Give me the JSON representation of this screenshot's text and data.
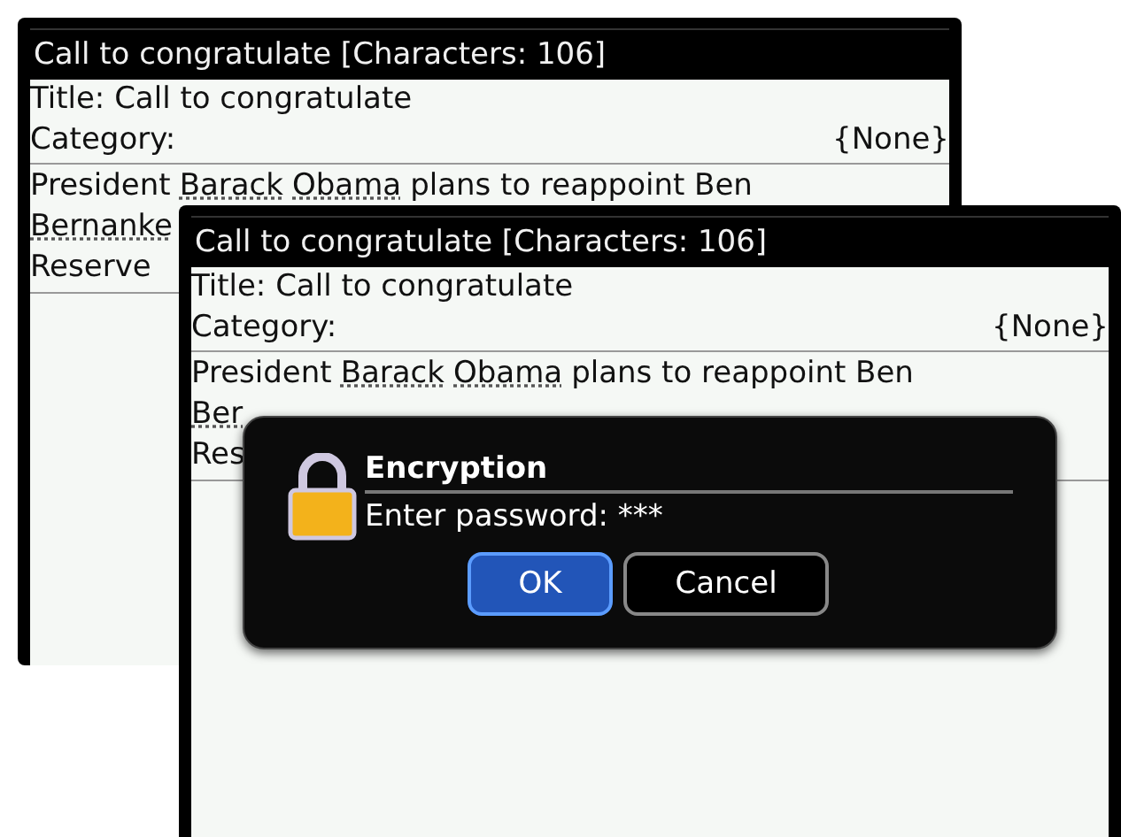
{
  "screens": [
    {
      "title": "Call to congratulate [Characters: 106]",
      "title_field": "Title: Call to congratulate",
      "category": {
        "label": "Category:",
        "value": "{None}"
      },
      "body": [
        [
          {
            "text": "President",
            "underlined": false
          },
          {
            "text": "Barack",
            "underlined": true
          },
          {
            "text": "Obama",
            "underlined": true
          },
          {
            "text": "plans to reappoint Ben",
            "underlined": false
          }
        ],
        [
          {
            "text": "Bernanke",
            "underlined": true
          }
        ],
        [
          {
            "text": "Reserve",
            "underlined": false
          }
        ]
      ]
    },
    {
      "title": "Call to congratulate [Characters: 106]",
      "title_field": "Title: Call to congratulate",
      "category": {
        "label": "Category:",
        "value": "{None}"
      },
      "body": [
        [
          {
            "text": "President",
            "underlined": false
          },
          {
            "text": "Barack",
            "underlined": true
          },
          {
            "text": "Obama",
            "underlined": true
          },
          {
            "text": "plans to reappoint Ben",
            "underlined": false
          }
        ],
        [
          {
            "text": "Ber",
            "underlined": true
          }
        ],
        [
          {
            "text": "Res",
            "underlined": false
          }
        ]
      ],
      "dialog": {
        "title": "Encryption",
        "prompt": "Enter password: ***",
        "buttons": [
          {
            "label": "OK",
            "selected": true
          },
          {
            "label": "Cancel",
            "selected": false
          }
        ]
      }
    }
  ]
}
